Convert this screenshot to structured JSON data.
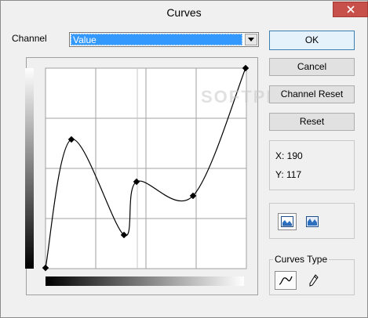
{
  "window": {
    "title": "Curves"
  },
  "channel": {
    "label": "Channel",
    "selected": "Value"
  },
  "buttons": {
    "ok": "OK",
    "cancel": "Cancel",
    "channel_reset": "Channel Reset",
    "reset": "Reset"
  },
  "coordinates": {
    "x": "X: 190",
    "y": "Y: 117"
  },
  "curves_type": {
    "label": "Curves Type"
  },
  "watermark": "SOFTPEDIA",
  "curve_points": [
    {
      "in": 0,
      "out": 0
    },
    {
      "in": 33,
      "out": 164
    },
    {
      "in": 100,
      "out": 42
    },
    {
      "in": 116,
      "out": 110
    },
    {
      "in": 188,
      "out": 92
    },
    {
      "in": 255,
      "out": 255
    }
  ],
  "icons": {
    "close": "close-icon",
    "dropdown": "chevron-down-icon",
    "display_normal": "histogram-icon",
    "display_alt": "histogram-alt-icon",
    "smooth_curve": "smooth-curve-icon",
    "freehand": "pencil-icon"
  }
}
